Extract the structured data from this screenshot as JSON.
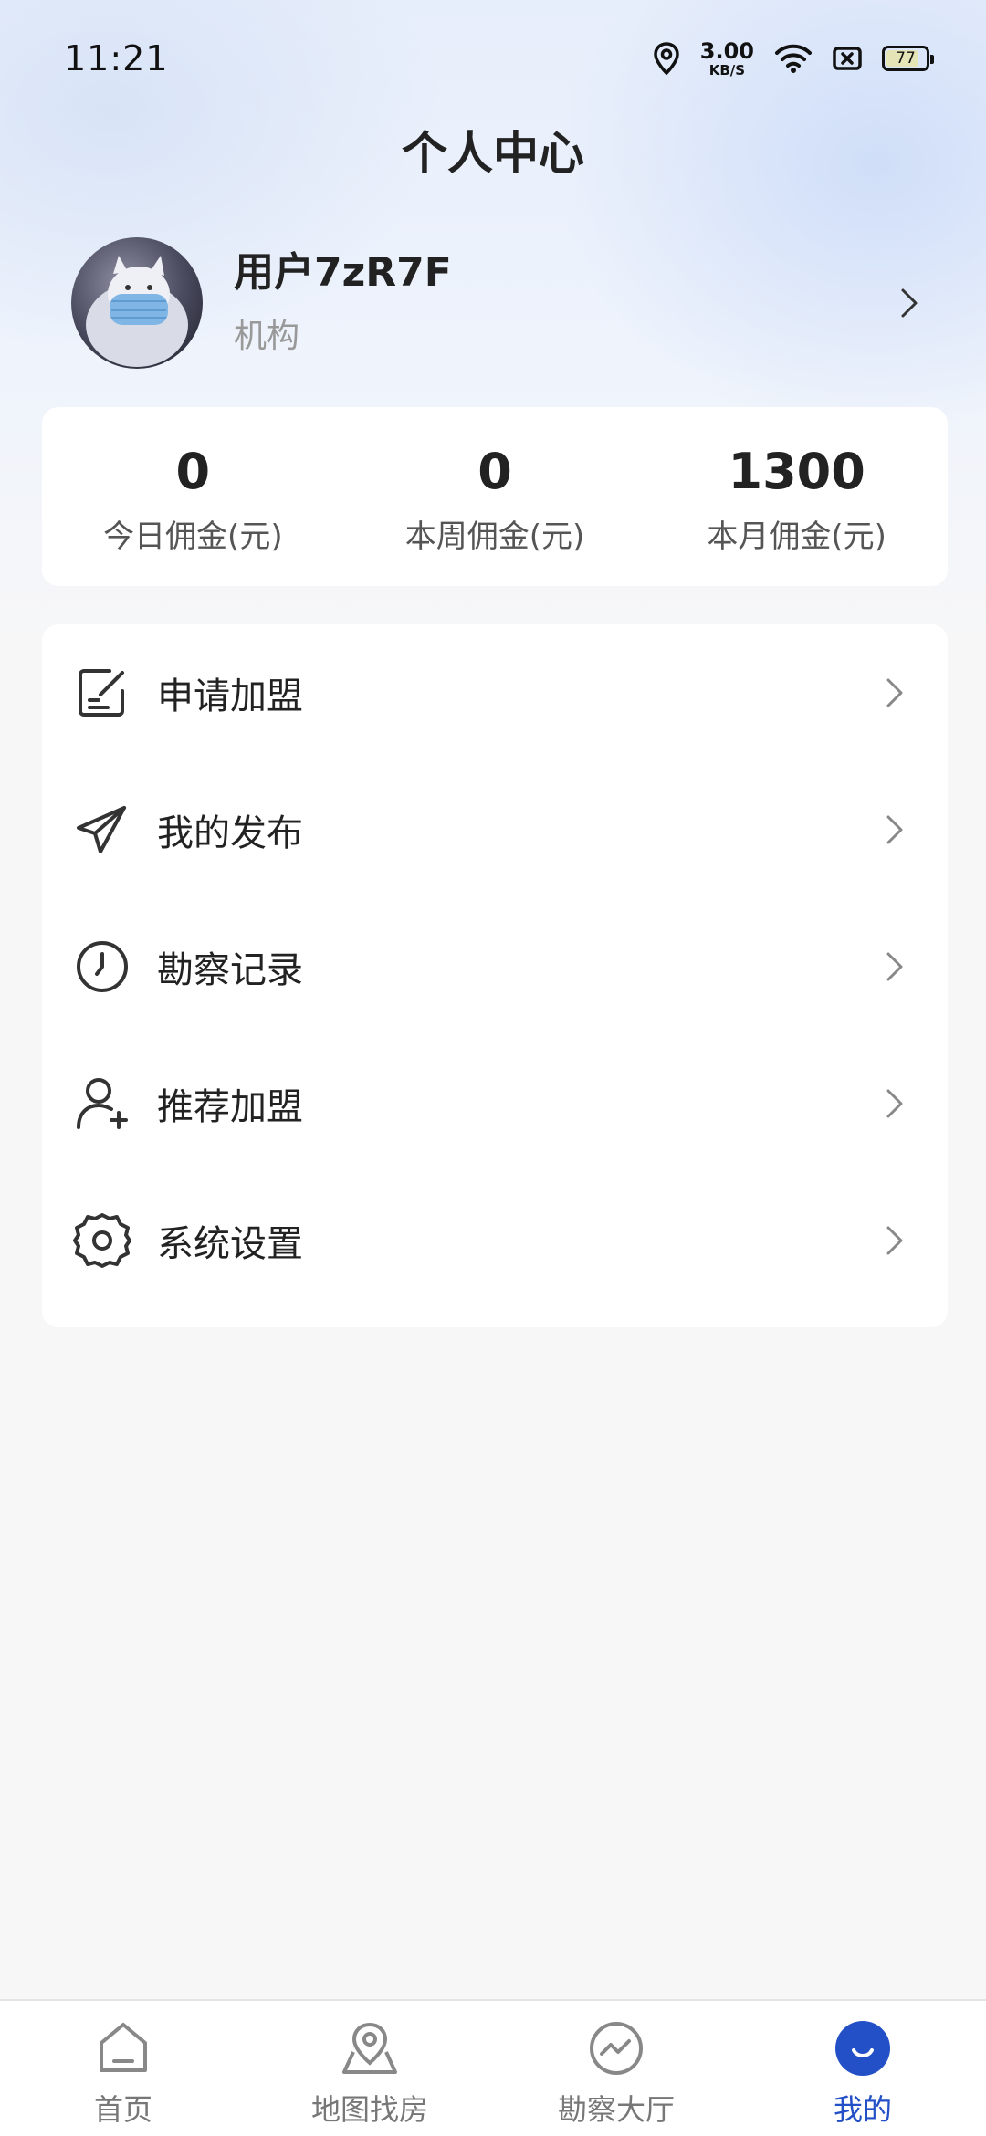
{
  "status_bar": {
    "time": "11:21",
    "net_speed_value": "3.00",
    "net_speed_unit": "KB/S",
    "battery_level": "77"
  },
  "header": {
    "title": "个人中心"
  },
  "profile": {
    "name": "用户7zR7F",
    "role": "机构"
  },
  "stats": [
    {
      "value": "0",
      "label": "今日佣金(元)"
    },
    {
      "value": "0",
      "label": "本周佣金(元)"
    },
    {
      "value": "1300",
      "label": "本月佣金(元)"
    }
  ],
  "menu": [
    {
      "label": "申请加盟",
      "icon": "edit-note-icon"
    },
    {
      "label": "我的发布",
      "icon": "paper-plane-icon"
    },
    {
      "label": "勘察记录",
      "icon": "clock-icon"
    },
    {
      "label": "推荐加盟",
      "icon": "add-user-icon"
    },
    {
      "label": "系统设置",
      "icon": "gear-icon"
    }
  ],
  "tabs": [
    {
      "label": "首页",
      "icon": "home-icon"
    },
    {
      "label": "地图找房",
      "icon": "map-pin-icon"
    },
    {
      "label": "勘察大厅",
      "icon": "trend-icon"
    },
    {
      "label": "我的",
      "icon": "smile-icon",
      "active": true
    }
  ],
  "colors": {
    "accent": "#2350c7",
    "text": "#222222",
    "muted": "#999999",
    "background": "#f7f7f8"
  }
}
